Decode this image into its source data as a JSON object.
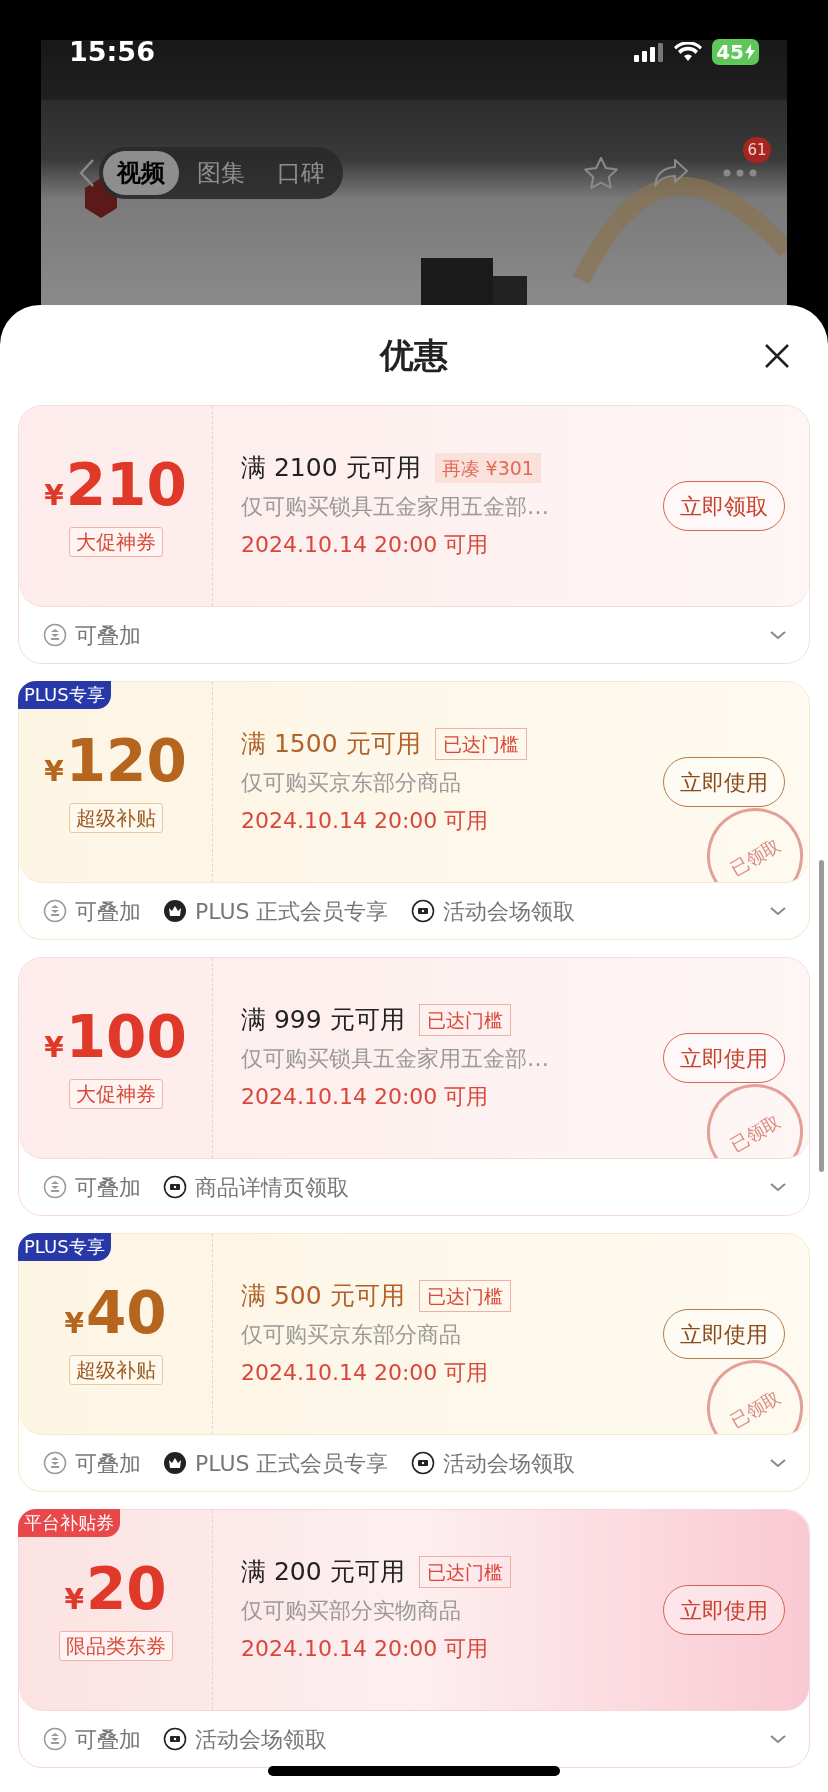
{
  "status_bar": {
    "time": "15:56",
    "battery": "45"
  },
  "media_tabs": [
    {
      "label": "视频",
      "selected": true
    },
    {
      "label": "图集",
      "selected": false
    },
    {
      "label": "口碑",
      "selected": false
    }
  ],
  "more_badge": "61",
  "sheet": {
    "title": "优惠"
  },
  "coupons": [
    {
      "color": "#e0392a",
      "currency": "¥",
      "amount": "210",
      "tag": "大促神券",
      "condition": "满 2100 元可用",
      "condition_note": {
        "kind": "shortfall",
        "text": "再凑 ¥301"
      },
      "scope": "仅可购买锁具五金家用五金部…",
      "time": "2024.10.14 20:00 可用",
      "button": "立即领取",
      "features": [
        {
          "kind": "stack",
          "text": "可叠加"
        }
      ]
    },
    {
      "color": "#b5651d",
      "corner_badge": {
        "kind": "plus",
        "text": "PLUS专享"
      },
      "currency": "¥",
      "amount": "120",
      "tag": "超级补贴",
      "condition": "满 1500 元可用",
      "condition_note": {
        "kind": "reached",
        "text": "已达门槛"
      },
      "scope": "仅可购买京东部分商品",
      "time": "2024.10.14 20:00 可用",
      "button": "立即使用",
      "stamp": "已领取",
      "features": [
        {
          "kind": "stack",
          "text": "可叠加"
        },
        {
          "kind": "crown",
          "text": "PLUS 正式会员专享"
        },
        {
          "kind": "ticket",
          "text": "活动会场领取"
        }
      ]
    },
    {
      "color": "#e0392a",
      "currency": "¥",
      "amount": "100",
      "tag": "大促神券",
      "condition": "满 999 元可用",
      "condition_note": {
        "kind": "reached",
        "text": "已达门槛"
      },
      "scope": "仅可购买锁具五金家用五金部…",
      "time": "2024.10.14 20:00 可用",
      "button": "立即使用",
      "stamp": "已领取",
      "features": [
        {
          "kind": "stack",
          "text": "可叠加"
        },
        {
          "kind": "ticket",
          "text": "商品详情页领取"
        }
      ]
    },
    {
      "color": "#b5651d",
      "corner_badge": {
        "kind": "plus",
        "text": "PLUS专享"
      },
      "currency": "¥",
      "amount": "40",
      "tag": "超级补贴",
      "condition": "满 500 元可用",
      "condition_note": {
        "kind": "reached",
        "text": "已达门槛"
      },
      "scope": "仅可购买京东部分商品",
      "time": "2024.10.14 20:00 可用",
      "button": "立即使用",
      "stamp": "已领取",
      "features": [
        {
          "kind": "stack",
          "text": "可叠加"
        },
        {
          "kind": "crown",
          "text": "PLUS 正式会员专享"
        },
        {
          "kind": "ticket",
          "text": "活动会场领取"
        }
      ]
    },
    {
      "color": "#e0392a",
      "corner_badge": {
        "kind": "platform",
        "text": "平台补贴券"
      },
      "currency": "¥",
      "amount": "20",
      "tag": "限品类东券",
      "condition": "满 200 元可用",
      "condition_note": {
        "kind": "reached",
        "text": "已达门槛"
      },
      "scope": "仅可购买部分实物商品",
      "time": "2024.10.14 20:00 可用",
      "button": "立即使用",
      "features": [
        {
          "kind": "stack",
          "text": "可叠加"
        },
        {
          "kind": "ticket",
          "text": "活动会场领取"
        }
      ]
    }
  ]
}
